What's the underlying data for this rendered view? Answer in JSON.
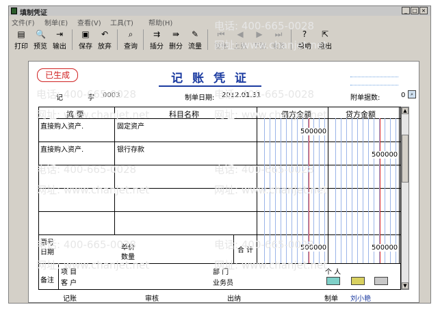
{
  "window": {
    "title": "填制凭证",
    "buttons": {
      "min": "_",
      "max": "□",
      "close": "×"
    }
  },
  "menu": [
    "文件(F)",
    "制单(E)",
    "查看(V)",
    "工具(T)",
    "帮助(H)"
  ],
  "toolbar": [
    {
      "label": "打印",
      "icon": "printer-icon",
      "glyph": "▤",
      "enabled": true
    },
    {
      "label": "预览",
      "icon": "preview-icon",
      "glyph": "🔍",
      "enabled": true
    },
    {
      "label": "输出",
      "icon": "export-icon",
      "glyph": "⇥",
      "enabled": true
    },
    {
      "label": "保存",
      "icon": "save-icon",
      "glyph": "▣",
      "enabled": true
    },
    {
      "label": "放弃",
      "icon": "undo-icon",
      "glyph": "↶",
      "enabled": true
    },
    {
      "label": "查询",
      "icon": "binoculars-icon",
      "glyph": "⌕",
      "enabled": true
    },
    {
      "label": "插分",
      "icon": "insert-row-icon",
      "glyph": "⇉",
      "enabled": true
    },
    {
      "label": "删分",
      "icon": "delete-row-icon",
      "glyph": "⇛",
      "enabled": true
    },
    {
      "label": "流量",
      "icon": "flow-icon",
      "glyph": "✎",
      "enabled": true
    },
    {
      "label": "首张",
      "icon": "first-icon",
      "glyph": "⏮",
      "enabled": false
    },
    {
      "label": "上张",
      "icon": "prev-icon",
      "glyph": "◀",
      "enabled": false
    },
    {
      "label": "下张",
      "icon": "next-icon",
      "glyph": "▶",
      "enabled": false
    },
    {
      "label": "末张",
      "icon": "last-icon",
      "glyph": "⏭",
      "enabled": false
    },
    {
      "label": "帮助",
      "icon": "help-icon",
      "glyph": "?",
      "enabled": true
    },
    {
      "label": "退出",
      "icon": "exit-icon",
      "glyph": "⇱",
      "enabled": true
    }
  ],
  "voucher": {
    "stamp": "已生成",
    "title": "记 账 凭 证",
    "type_label": "记",
    "no_label": "字",
    "no_value": "0003",
    "date_label": "制单日期:",
    "date_value": "2012.01.31",
    "attach_label": "附单据数:",
    "attach_value": "0",
    "col_summary": "摘 要",
    "col_account": "科目名称",
    "col_debit": "借方金额",
    "col_credit": "贷方金额",
    "rows": [
      {
        "summary": "直接购入资产.",
        "account": "固定资产",
        "debit": "500000",
        "credit": ""
      },
      {
        "summary": "直接购入资产.",
        "account": "银行存款",
        "debit": "",
        "credit": "500000"
      },
      {
        "summary": "",
        "account": "",
        "debit": "",
        "credit": ""
      },
      {
        "summary": "",
        "account": "",
        "debit": "",
        "credit": ""
      },
      {
        "summary": "",
        "account": "",
        "debit": "",
        "credit": ""
      }
    ],
    "ticket_label": "票号",
    "date2_label": "日期",
    "price_label": "单价",
    "qty_label": "数量",
    "total_label": "合 计",
    "total_debit": "500000",
    "total_credit": "500000",
    "remark_label": "备注",
    "project_label": "项 目",
    "customer_label": "客 户",
    "dept_label": "部 门",
    "salesman_label": "业务员",
    "person_label": "个 人",
    "footer": {
      "bookkeep": "记账",
      "audit": "审核",
      "cashier": "出纳",
      "maker": "制单",
      "maker_name": "刘小艳"
    }
  },
  "watermark": {
    "phone": "电话: 400-665-0028",
    "site": "网址: www.chanjet.net"
  }
}
